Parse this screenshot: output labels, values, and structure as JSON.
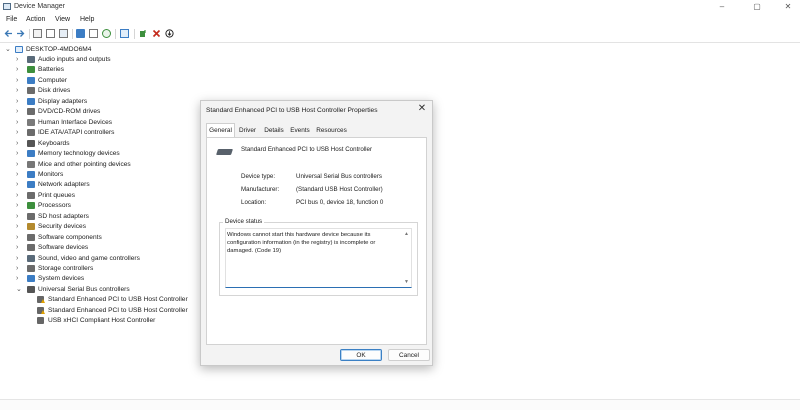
{
  "window": {
    "title": "Device Manager",
    "controls": [
      "–",
      "▢",
      "✕"
    ]
  },
  "menu": [
    "File",
    "Action",
    "View",
    "Help"
  ],
  "tree": {
    "root": "DESKTOP-4MDO6M4",
    "categories": [
      {
        "label": "Audio inputs and outputs",
        "color": "#5a6b7a"
      },
      {
        "label": "Batteries",
        "color": "#3d8f3d"
      },
      {
        "label": "Computer",
        "color": "#3c7dc4"
      },
      {
        "label": "Disk drives",
        "color": "#6b6b6b"
      },
      {
        "label": "Display adapters",
        "color": "#3c7dc4"
      },
      {
        "label": "DVD/CD-ROM drives",
        "color": "#6b6b6b"
      },
      {
        "label": "Human Interface Devices",
        "color": "#7a7a7a"
      },
      {
        "label": "IDE ATA/ATAPI controllers",
        "color": "#6b6b6b"
      },
      {
        "label": "Keyboards",
        "color": "#555555"
      },
      {
        "label": "Memory technology devices",
        "color": "#3c7dc4"
      },
      {
        "label": "Mice and other pointing devices",
        "color": "#777777"
      },
      {
        "label": "Monitors",
        "color": "#3c7dc4"
      },
      {
        "label": "Network adapters",
        "color": "#3c7dc4"
      },
      {
        "label": "Print queues",
        "color": "#6b6b6b"
      },
      {
        "label": "Processors",
        "color": "#3d8f3d"
      },
      {
        "label": "SD host adapters",
        "color": "#6b6b6b"
      },
      {
        "label": "Security devices",
        "color": "#b38a2e"
      },
      {
        "label": "Software components",
        "color": "#6b6b6b"
      },
      {
        "label": "Software devices",
        "color": "#6b6b6b"
      },
      {
        "label": "Sound, video and game controllers",
        "color": "#5a6b7a"
      },
      {
        "label": "Storage controllers",
        "color": "#6b6b6b"
      },
      {
        "label": "System devices",
        "color": "#3c7dc4"
      },
      {
        "label": "Universal Serial Bus controllers",
        "color": "#555555"
      }
    ],
    "usb_children": [
      {
        "label": "Standard Enhanced PCI to USB Host Controller",
        "warning": true
      },
      {
        "label": "Standard Enhanced PCI to USB Host Controller",
        "warning": true
      },
      {
        "label": "USB xHCI Compliant Host Controller",
        "warning": false
      }
    ]
  },
  "dialog": {
    "title": "Standard Enhanced PCI to USB Host Controller Properties",
    "close": "✕",
    "tabs": [
      "General",
      "Driver",
      "Details",
      "Events",
      "Resources"
    ],
    "device_name": "Standard Enhanced PCI to USB Host Controller",
    "properties": [
      {
        "key": "Device type:",
        "value": "Universal Serial Bus controllers"
      },
      {
        "key": "Manufacturer:",
        "value": "(Standard USB Host Controller)"
      },
      {
        "key": "Location:",
        "value": "PCI bus 0, device 18, function 0"
      }
    ],
    "status_legend": "Device status",
    "status_text": "Windows cannot start this hardware device because its configuration information (in the registry) is incomplete or damaged. (Code 19)",
    "ok": "OK",
    "cancel": "Cancel"
  },
  "colors": {
    "accent": "#2b6fb3",
    "error_red": "#c42b1c"
  }
}
